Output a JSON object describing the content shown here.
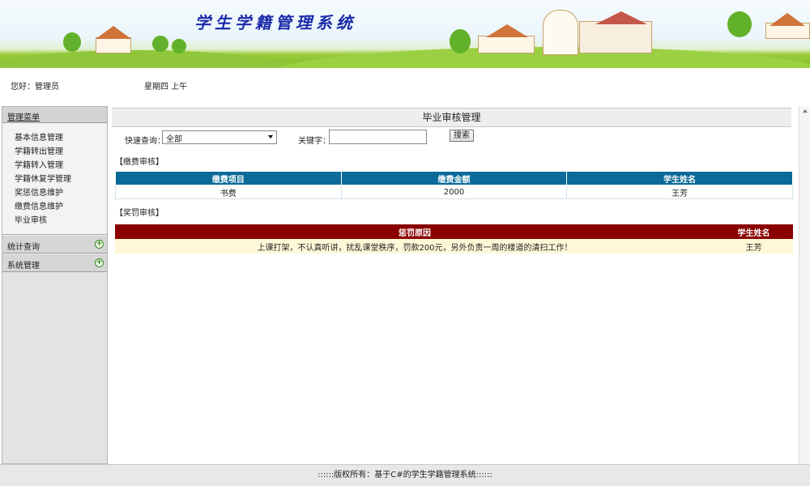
{
  "banner": {
    "title": "学生学籍管理系统"
  },
  "greeting": {
    "user": "您好：管理员",
    "date": "星期四  上午"
  },
  "menu": {
    "header": "管理菜单",
    "items": [
      "基本信息管理",
      "学籍转出管理",
      "学籍转入管理",
      "学籍休复学管理",
      "奖惩信息维护",
      "缴费信息维护",
      "毕业审核"
    ],
    "groups": [
      {
        "label": "统计查询",
        "icon": "expand-icon"
      },
      {
        "label": "系统管理",
        "icon": "expand-icon"
      }
    ]
  },
  "main": {
    "title": "毕业审核管理",
    "filter": {
      "quick_label": "快速查询：",
      "quick_value": "全部",
      "keyword_label": "关键字：",
      "keyword_value": "",
      "search_button": "搜索"
    },
    "fee_section": {
      "label": "【缴费审核】",
      "columns": [
        "缴费项目",
        "缴费金额",
        "学生姓名"
      ],
      "rows": [
        [
          "书费",
          "2000",
          "王芳"
        ]
      ],
      "header_color": "#0b6a98"
    },
    "reward_section": {
      "label": "【奖罚审核】",
      "columns": [
        "惩罚原因",
        "学生姓名"
      ],
      "rows": [
        [
          "上课打架，不认真听讲，扰乱课堂秩序，罚款200元，另外负责一周的楼道的清扫工作！",
          "王芳"
        ]
      ],
      "header_color": "#8a0000"
    }
  },
  "footer": {
    "text": "::::::版权所有：基于C#的学生学籍管理系统::::::"
  }
}
